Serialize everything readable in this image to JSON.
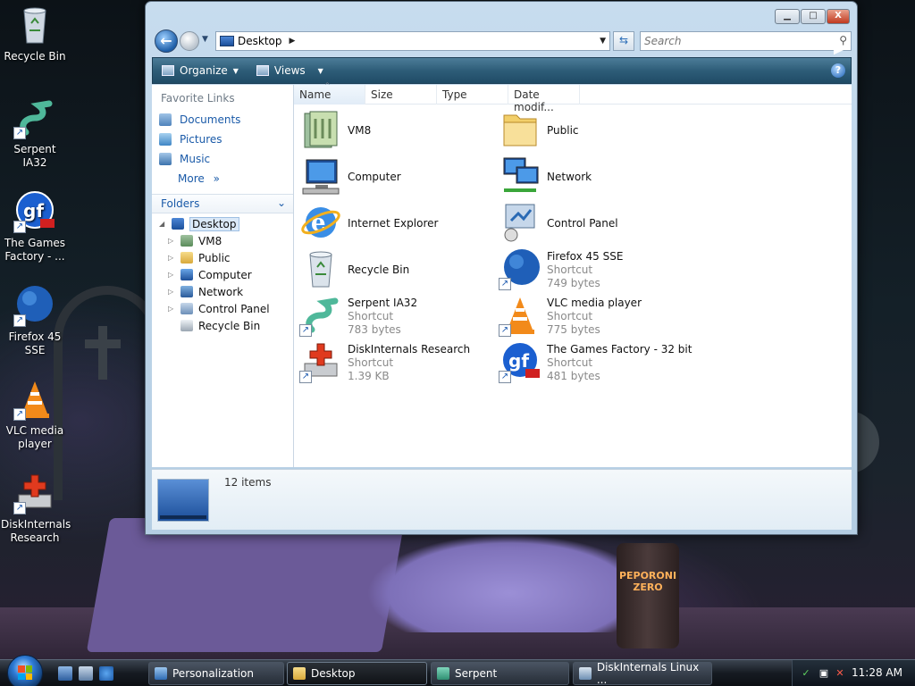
{
  "desktop": {
    "icons": [
      {
        "label": "Recycle Bin",
        "icon": "recycle-bin-icon"
      },
      {
        "label": "Serpent IA32",
        "icon": "serpent-icon"
      },
      {
        "label": "The Games Factory - ...",
        "icon": "games-factory-icon"
      },
      {
        "label": "Firefox 45 SSE",
        "icon": "firefox-icon"
      },
      {
        "label": "VLC media player",
        "icon": "vlc-icon"
      },
      {
        "label": "DiskInternals Research",
        "icon": "diskinternals-icon"
      }
    ],
    "can_label": "PEPORONI ZERO"
  },
  "window": {
    "caption_buttons": {
      "minimize": "▁",
      "maximize": "□",
      "close": "X"
    },
    "nav": {
      "address": "Desktop",
      "search_placeholder": "Search"
    },
    "command_bar": {
      "organize": "Organize",
      "views": "Views",
      "help": "?"
    },
    "favorite_links": {
      "title": "Favorite Links",
      "items": [
        "Documents",
        "Pictures",
        "Music"
      ],
      "more": "More"
    },
    "folders": {
      "title": "Folders",
      "tree": [
        "Desktop",
        "VM8",
        "Public",
        "Computer",
        "Network",
        "Control Panel",
        "Recycle Bin"
      ]
    },
    "columns": [
      "Name",
      "Size",
      "Type",
      "Date modif..."
    ],
    "items": [
      {
        "name": "VM8",
        "sub1": "",
        "sub2": "",
        "icon": "folder-icon"
      },
      {
        "name": "Public",
        "sub1": "",
        "sub2": "",
        "icon": "folder-icon"
      },
      {
        "name": "Computer",
        "sub1": "",
        "sub2": "",
        "icon": "computer-icon"
      },
      {
        "name": "Network",
        "sub1": "",
        "sub2": "",
        "icon": "network-icon"
      },
      {
        "name": "Internet Explorer",
        "sub1": "",
        "sub2": "",
        "icon": "internet-explorer-icon"
      },
      {
        "name": "Control Panel",
        "sub1": "",
        "sub2": "",
        "icon": "control-panel-icon"
      },
      {
        "name": "Recycle Bin",
        "sub1": "",
        "sub2": "",
        "icon": "recycle-bin-icon"
      },
      {
        "name": "Firefox 45 SSE",
        "sub1": "Shortcut",
        "sub2": "749 bytes",
        "icon": "firefox-icon"
      },
      {
        "name": "Serpent IA32",
        "sub1": "Shortcut",
        "sub2": "783 bytes",
        "icon": "serpent-icon"
      },
      {
        "name": "VLC media player",
        "sub1": "Shortcut",
        "sub2": "775 bytes",
        "icon": "vlc-icon"
      },
      {
        "name": "DiskInternals Research",
        "sub1": "Shortcut",
        "sub2": "1.39 KB",
        "icon": "diskinternals-icon"
      },
      {
        "name": "The Games Factory - 32 bit",
        "sub1": "Shortcut",
        "sub2": "481 bytes",
        "icon": "games-factory-icon"
      }
    ],
    "details": {
      "count": "12 items"
    }
  },
  "taskbar": {
    "buttons": [
      "Personalization",
      "Desktop",
      "Serpent",
      "DiskInternals Linux ..."
    ],
    "time": "11:28 AM"
  }
}
